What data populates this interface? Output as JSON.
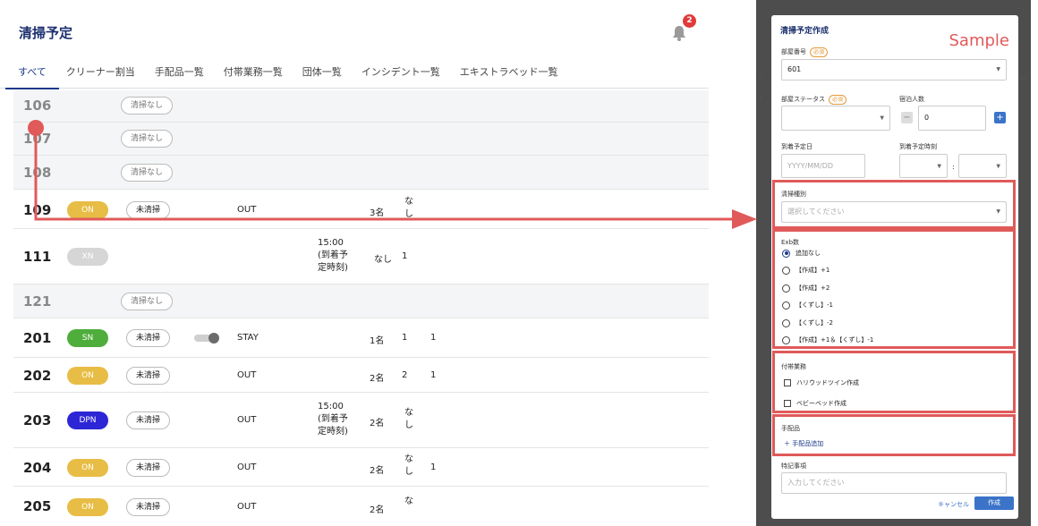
{
  "header": {
    "title": "清掃予定",
    "notification_count": "2"
  },
  "tabs": [
    {
      "label": "すべて",
      "active": true
    },
    {
      "label": "クリーナー割当"
    },
    {
      "label": "手配品一覧"
    },
    {
      "label": "付帯業務一覧"
    },
    {
      "label": "団体一覧"
    },
    {
      "label": "インシデント一覧"
    },
    {
      "label": "エキストラベッド一覧"
    }
  ],
  "rows": [
    {
      "room": "106",
      "empty": true,
      "clean": "清掃なし"
    },
    {
      "room": "107",
      "empty": true,
      "clean": "清掃なし"
    },
    {
      "room": "108",
      "empty": true,
      "clean": "清掃なし"
    },
    {
      "room": "109",
      "status": "ON",
      "clean": "未清掃",
      "type": "OUT",
      "guests": "3名",
      "note": "な\nし"
    },
    {
      "room": "111",
      "status": "XN",
      "arrival": "15:00\n(到着予\n定時刻)",
      "note": "なし",
      "count": "1"
    },
    {
      "room": "121",
      "empty": true,
      "clean": "清掃なし"
    },
    {
      "room": "201",
      "status": "SN",
      "clean": "未清掃",
      "type": "STAY",
      "guests": "1名",
      "c1": "1",
      "c2": "1"
    },
    {
      "room": "202",
      "status": "ON",
      "clean": "未清掃",
      "type": "OUT",
      "guests": "2名",
      "c1": "2",
      "c2": "1"
    },
    {
      "room": "203",
      "status": "DPN",
      "clean": "未清掃",
      "type": "OUT",
      "arrival": "15:00\n(到着予\n定時刻)",
      "guests": "2名",
      "note": "な\nし"
    },
    {
      "room": "204",
      "status": "ON",
      "clean": "未清掃",
      "type": "OUT",
      "guests": "2名",
      "note": "な\nし",
      "c2": "1"
    },
    {
      "room": "205",
      "status": "ON",
      "clean": "未清掃",
      "type": "OUT",
      "guests": "2名",
      "note": "な"
    }
  ],
  "colors": {
    "ON": "#e8bd45",
    "XN": "#d6d6d6",
    "SN": "#4fad3c",
    "DPN": "#2d26d6",
    "accent": "#1b3a8a",
    "highlight": "#e05a5a"
  },
  "modal": {
    "title": "清掃予定作成",
    "watermark": "Sample",
    "room_label": "部屋番号",
    "required": "必須",
    "room_value": "601",
    "status_label": "部屋ステータス",
    "guests_label": "宿泊人数",
    "guests_value": "0",
    "arrival_date_label": "到着予定日",
    "arrival_date_placeholder": "YYYY/MM/DD",
    "arrival_time_label": "到着予定時刻",
    "time_sep": ":",
    "clean_type_label": "清掃種別",
    "clean_type_placeholder": "選択してください",
    "exb_label": "Exb数",
    "exb_options": [
      {
        "label": "追加なし",
        "selected": true
      },
      {
        "label": "【作成】+1"
      },
      {
        "label": "【作成】+2"
      },
      {
        "label": "【くずし】-1"
      },
      {
        "label": "【くずし】-2"
      },
      {
        "label": "【作成】+1＆【くずし】-1"
      }
    ],
    "extra_label": "付帯業務",
    "extra_options": [
      "ハリウッドツイン作成",
      "ベビーベッド作成"
    ],
    "supplies_label": "手配品",
    "supplies_add": "＋ 手配品追加",
    "notes_label": "特記事項",
    "notes_placeholder": "入力してください",
    "cancel": "キャンセル",
    "create": "作成"
  }
}
